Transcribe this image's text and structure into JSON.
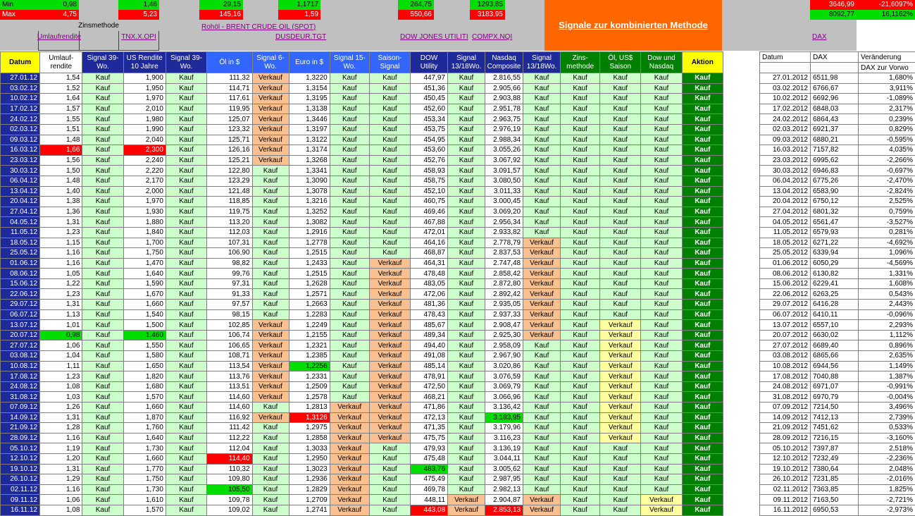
{
  "top": {
    "min_label": "Min",
    "max_label": "Max",
    "min_vals": [
      "0,98",
      "1,46",
      "29,15",
      "1,1717",
      "264,75",
      "1293,85"
    ],
    "max_vals": [
      "4,75",
      "5,23",
      "145,16",
      "1,59",
      "550,66",
      "3183,95"
    ],
    "dax_min": [
      "3646,99",
      "-21,6097%"
    ],
    "dax_max": [
      "8092,77",
      "16,1162%"
    ],
    "zinsmethode": "Zinsmethode",
    "links": {
      "umlauf": "Umlaufrendite",
      "tnx": "TNX.X.OPI",
      "oil": "Rohöl - BRENT CRUDE OIL (SPOT)",
      "eur": "DUSDEUR.TGT",
      "dow": "DOW JONES UTILITI",
      "compx": "COMPX.NQI",
      "dax": "DAX"
    },
    "signal_title": "Signale zur kombinierten Methode"
  },
  "headers": {
    "datum": "Datum",
    "umlauf": "Umlauf-rendite",
    "sig39a": "Signal 39-Wo.",
    "usr": "US Rendite 10 Jahre",
    "sig39b": "Signal 39-Wo.",
    "oel": "Öl in $",
    "sig6": "Signal 6-Wo.",
    "euro": "Euro in $",
    "sig15": "Signal 15-Wo.",
    "saison": "Saison-Signal",
    "dow": "DOW Utility",
    "sig13a": "Signal 13/18Wo.",
    "nasdaq": "Nasdaq Composite",
    "sig13b": "Signal 13/18Wo.",
    "zins": "Zins-methode",
    "oelus": "Öl, US$ Saison",
    "downdq": "Dow und Nasdaq",
    "aktion": "Aktion"
  },
  "dax_headers": {
    "datum": "Datum",
    "dax": "DAX",
    "ver": "Veränderung",
    "ver2": "DAX zur Vorwo"
  },
  "colors": {
    "navy": "#1e2a9a",
    "light_green": "#ccffcc",
    "orange": "#fac090",
    "dark_green": "#008000",
    "signal_orange": "#ff6600"
  },
  "rows": [
    [
      "27.01.12",
      "1,54",
      "Kauf",
      "1,900",
      "Kauf",
      "111,32",
      "Verkauf",
      "1,3220",
      "Kauf",
      "Kauf",
      "447,97",
      "Kauf",
      "2.816,55",
      "Kauf",
      "Kauf",
      "Kauf",
      "Kauf",
      "Kauf"
    ],
    [
      "03.02.12",
      "1,52",
      "Kauf",
      "1,950",
      "Kauf",
      "114,71",
      "Verkauf",
      "1,3154",
      "Kauf",
      "Kauf",
      "451,36",
      "Kauf",
      "2.905,66",
      "Kauf",
      "Kauf",
      "Kauf",
      "Kauf",
      "Kauf"
    ],
    [
      "10.02.12",
      "1,64",
      "Kauf",
      "1,970",
      "Kauf",
      "117,61",
      "Verkauf",
      "1,3195",
      "Kauf",
      "Kauf",
      "450,45",
      "Kauf",
      "2.903,88",
      "Kauf",
      "Kauf",
      "Kauf",
      "Kauf",
      "Kauf"
    ],
    [
      "17.02.12",
      "1,57",
      "Kauf",
      "2,010",
      "Kauf",
      "119,95",
      "Verkauf",
      "1,3138",
      "Kauf",
      "Kauf",
      "452,60",
      "Kauf",
      "2.951,78",
      "Kauf",
      "Kauf",
      "Kauf",
      "Kauf",
      "Kauf"
    ],
    [
      "24.02.12",
      "1,55",
      "Kauf",
      "1,980",
      "Kauf",
      "125,07",
      "Verkauf",
      "1,3446",
      "Kauf",
      "Kauf",
      "453,34",
      "Kauf",
      "2.963,75",
      "Kauf",
      "Kauf",
      "Kauf",
      "Kauf",
      "Kauf"
    ],
    [
      "02.03.12",
      "1,51",
      "Kauf",
      "1,990",
      "Kauf",
      "123,32",
      "Verkauf",
      "1,3197",
      "Kauf",
      "Kauf",
      "453,75",
      "Kauf",
      "2.976,19",
      "Kauf",
      "Kauf",
      "Kauf",
      "Kauf",
      "Kauf"
    ],
    [
      "09.03.12",
      "1,48",
      "Kauf",
      "2,040",
      "Kauf",
      "125,71",
      "Verkauf",
      "1,3122",
      "Kauf",
      "Kauf",
      "454,95",
      "Kauf",
      "2.988,34",
      "Kauf",
      "Kauf",
      "Kauf",
      "Kauf",
      "Kauf"
    ],
    [
      "16.03.12",
      "1,66",
      "Kauf",
      "2,300",
      "Kauf",
      "126,16",
      "Verkauf",
      "1,3174",
      "Kauf",
      "Kauf",
      "453,60",
      "Kauf",
      "3.055,26",
      "Kauf",
      "Kauf",
      "Kauf",
      "Kauf",
      "Kauf"
    ],
    [
      "23.03.12",
      "1,56",
      "Kauf",
      "2,240",
      "Kauf",
      "125,21",
      "Verkauf",
      "1,3268",
      "Kauf",
      "Kauf",
      "452,76",
      "Kauf",
      "3.067,92",
      "Kauf",
      "Kauf",
      "Kauf",
      "Kauf",
      "Kauf"
    ],
    [
      "30.03.12",
      "1,50",
      "Kauf",
      "2,220",
      "Kauf",
      "122,80",
      "Kauf",
      "1,3341",
      "Kauf",
      "Kauf",
      "458,93",
      "Kauf",
      "3.091,57",
      "Kauf",
      "Kauf",
      "Kauf",
      "Kauf",
      "Kauf"
    ],
    [
      "06.04.12",
      "1,48",
      "Kauf",
      "2,170",
      "Kauf",
      "123,29",
      "Kauf",
      "1,3090",
      "Kauf",
      "Kauf",
      "458,75",
      "Kauf",
      "3.080,50",
      "Kauf",
      "Kauf",
      "Kauf",
      "Kauf",
      "Kauf"
    ],
    [
      "13.04.12",
      "1,40",
      "Kauf",
      "2,000",
      "Kauf",
      "121,48",
      "Kauf",
      "1,3078",
      "Kauf",
      "Kauf",
      "452,10",
      "Kauf",
      "3.011,33",
      "Kauf",
      "Kauf",
      "Kauf",
      "Kauf",
      "Kauf"
    ],
    [
      "20.04.12",
      "1,38",
      "Kauf",
      "1,970",
      "Kauf",
      "118,85",
      "Kauf",
      "1,3216",
      "Kauf",
      "Kauf",
      "460,75",
      "Kauf",
      "3.000,45",
      "Kauf",
      "Kauf",
      "Kauf",
      "Kauf",
      "Kauf"
    ],
    [
      "27.04.12",
      "1,36",
      "Kauf",
      "1,930",
      "Kauf",
      "119,75",
      "Kauf",
      "1,3252",
      "Kauf",
      "Kauf",
      "469,46",
      "Kauf",
      "3.069,20",
      "Kauf",
      "Kauf",
      "Kauf",
      "Kauf",
      "Kauf"
    ],
    [
      "04.05.12",
      "1,31",
      "Kauf",
      "1,880",
      "Kauf",
      "113,20",
      "Kauf",
      "1,3082",
      "Kauf",
      "Kauf",
      "467,88",
      "Kauf",
      "2.956,34",
      "Kauf",
      "Kauf",
      "Kauf",
      "Kauf",
      "Kauf"
    ],
    [
      "11.05.12",
      "1,23",
      "Kauf",
      "1,840",
      "Kauf",
      "112,03",
      "Kauf",
      "1,2916",
      "Kauf",
      "Kauf",
      "472,01",
      "Kauf",
      "2.933,82",
      "Kauf",
      "Kauf",
      "Kauf",
      "Kauf",
      "Kauf"
    ],
    [
      "18.05.12",
      "1,15",
      "Kauf",
      "1,700",
      "Kauf",
      "107,31",
      "Kauf",
      "1,2778",
      "Kauf",
      "Kauf",
      "464,16",
      "Kauf",
      "2.778,79",
      "Verkauf",
      "Kauf",
      "Kauf",
      "Kauf",
      "Kauf"
    ],
    [
      "25.05.12",
      "1,16",
      "Kauf",
      "1,750",
      "Kauf",
      "106,90",
      "Kauf",
      "1,2515",
      "Kauf",
      "Kauf",
      "468,87",
      "Kauf",
      "2.837,53",
      "Verkauf",
      "Kauf",
      "Kauf",
      "Kauf",
      "Kauf"
    ],
    [
      "01.06.12",
      "1,16",
      "Kauf",
      "1,470",
      "Kauf",
      "98,82",
      "Kauf",
      "1,2433",
      "Kauf",
      "Verkauf",
      "464,31",
      "Kauf",
      "2.747,48",
      "Verkauf",
      "Kauf",
      "Kauf",
      "Kauf",
      "Kauf"
    ],
    [
      "08.06.12",
      "1,05",
      "Kauf",
      "1,640",
      "Kauf",
      "99,76",
      "Kauf",
      "1,2515",
      "Kauf",
      "Verkauf",
      "478,48",
      "Kauf",
      "2.858,42",
      "Verkauf",
      "Kauf",
      "Kauf",
      "Kauf",
      "Kauf"
    ],
    [
      "15.06.12",
      "1,22",
      "Kauf",
      "1,590",
      "Kauf",
      "97,31",
      "Kauf",
      "1,2628",
      "Kauf",
      "Verkauf",
      "483,05",
      "Kauf",
      "2.872,80",
      "Verkauf",
      "Kauf",
      "Kauf",
      "Kauf",
      "Kauf"
    ],
    [
      "22.06.12",
      "1,23",
      "Kauf",
      "1,670",
      "Kauf",
      "91,33",
      "Kauf",
      "1,2571",
      "Kauf",
      "Verkauf",
      "472,06",
      "Kauf",
      "2.892,42",
      "Verkauf",
      "Kauf",
      "Kauf",
      "Kauf",
      "Kauf"
    ],
    [
      "29.07.12",
      "1,31",
      "Kauf",
      "1,660",
      "Kauf",
      "97,57",
      "Kauf",
      "1,2663",
      "Kauf",
      "Verkauf",
      "481,36",
      "Kauf",
      "2.935,05",
      "Verkauf",
      "Kauf",
      "Kauf",
      "Kauf",
      "Kauf"
    ],
    [
      "06.07.12",
      "1,13",
      "Kauf",
      "1,540",
      "Kauf",
      "98,15",
      "Kauf",
      "1,2283",
      "Kauf",
      "Verkauf",
      "478,43",
      "Kauf",
      "2.937,33",
      "Verkauf",
      "Kauf",
      "Kauf",
      "Kauf",
      "Kauf"
    ],
    [
      "13.07.12",
      "1,01",
      "Kauf",
      "1,500",
      "Kauf",
      "102,85",
      "Verkauf",
      "1,2249",
      "Kauf",
      "Verkauf",
      "485,67",
      "Kauf",
      "2.908,47",
      "Verkauf",
      "Kauf",
      "Verkauf",
      "Kauf",
      "Kauf"
    ],
    [
      "20.07.12",
      "0,98",
      "Kauf",
      "1,460",
      "Kauf",
      "106,74",
      "Verkauf",
      "1,2155",
      "Kauf",
      "Verkauf",
      "489,34",
      "Kauf",
      "2.925,30",
      "Verkauf",
      "Kauf",
      "Verkauf",
      "Kauf",
      "Kauf"
    ],
    [
      "27.07.12",
      "1,06",
      "Kauf",
      "1,550",
      "Kauf",
      "106,65",
      "Verkauf",
      "1,2321",
      "Kauf",
      "Verkauf",
      "494,40",
      "Kauf",
      "2.958,09",
      "Kauf",
      "Kauf",
      "Verkauf",
      "Kauf",
      "Kauf"
    ],
    [
      "03.08.12",
      "1,04",
      "Kauf",
      "1,580",
      "Kauf",
      "108,71",
      "Verkauf",
      "1,2385",
      "Kauf",
      "Verkauf",
      "491,08",
      "Kauf",
      "2.967,90",
      "Kauf",
      "Kauf",
      "Verkauf",
      "Kauf",
      "Kauf"
    ],
    [
      "10.08.12",
      "1,11",
      "Kauf",
      "1,650",
      "Kauf",
      "113,54",
      "Verkauf",
      "1,2256",
      "Kauf",
      "Verkauf",
      "485,14",
      "Kauf",
      "3.020,86",
      "Kauf",
      "Kauf",
      "Verkauf",
      "Kauf",
      "Kauf"
    ],
    [
      "17.08.12",
      "1,23",
      "Kauf",
      "1,820",
      "Kauf",
      "113,76",
      "Verkauf",
      "1,2331",
      "Kauf",
      "Verkauf",
      "478,91",
      "Kauf",
      "3.076,59",
      "Kauf",
      "Kauf",
      "Verkauf",
      "Kauf",
      "Kauf"
    ],
    [
      "24.08.12",
      "1,08",
      "Kauf",
      "1,680",
      "Kauf",
      "113,51",
      "Verkauf",
      "1,2509",
      "Kauf",
      "Verkauf",
      "472,50",
      "Kauf",
      "3.069,79",
      "Kauf",
      "Kauf",
      "Verkauf",
      "Kauf",
      "Kauf"
    ],
    [
      "31.08.12",
      "1,03",
      "Kauf",
      "1,570",
      "Kauf",
      "114,60",
      "Verkauf",
      "1,2578",
      "Kauf",
      "Verkauf",
      "468,21",
      "Kauf",
      "3.066,96",
      "Kauf",
      "Kauf",
      "Verkauf",
      "Kauf",
      "Kauf"
    ],
    [
      "07.09.12",
      "1,26",
      "Kauf",
      "1,660",
      "Kauf",
      "114,60",
      "Kauf",
      "1,2813",
      "Verkauf",
      "Verkauf",
      "471,86",
      "Kauf",
      "3.136,42",
      "Kauf",
      "Kauf",
      "Verkauf",
      "Kauf",
      "Kauf"
    ],
    [
      "14.09.12",
      "1,31",
      "Kauf",
      "1,870",
      "Kauf",
      "116,92",
      "Verkauf",
      "1,3126",
      "Verkauf",
      "Verkauf",
      "472,13",
      "Kauf",
      "3.183,95",
      "Kauf",
      "Kauf",
      "Verkauf",
      "Kauf",
      "Kauf"
    ],
    [
      "21.09.12",
      "1,28",
      "Kauf",
      "1,760",
      "Kauf",
      "111,42",
      "Kauf",
      "1,2975",
      "Verkauf",
      "Verkauf",
      "471,35",
      "Kauf",
      "3.179,96",
      "Kauf",
      "Kauf",
      "Verkauf",
      "Kauf",
      "Kauf"
    ],
    [
      "28.09.12",
      "1,16",
      "Kauf",
      "1,640",
      "Kauf",
      "112,22",
      "Kauf",
      "1,2858",
      "Verkauf",
      "Verkauf",
      "475,75",
      "Kauf",
      "3.116,23",
      "Kauf",
      "Kauf",
      "Verkauf",
      "Kauf",
      "Kauf"
    ],
    [
      "05.10.12",
      "1,19",
      "Kauf",
      "1,730",
      "Kauf",
      "112,04",
      "Kauf",
      "1,3033",
      "Verkauf",
      "Kauf",
      "479,93",
      "Kauf",
      "3.136,19",
      "Kauf",
      "Kauf",
      "Kauf",
      "Kauf",
      "Kauf"
    ],
    [
      "12.10.12",
      "1,20",
      "Kauf",
      "1,660",
      "Kauf",
      "114,40",
      "Kauf",
      "1,2950",
      "Verkauf",
      "Kauf",
      "475,48",
      "Kauf",
      "3.044,11",
      "Kauf",
      "Kauf",
      "Kauf",
      "Kauf",
      "Kauf"
    ],
    [
      "19.10.12",
      "1,31",
      "Kauf",
      "1,770",
      "Kauf",
      "110,32",
      "Kauf",
      "1,3023",
      "Verkauf",
      "Kauf",
      "483,76",
      "Kauf",
      "3.005,62",
      "Kauf",
      "Kauf",
      "Kauf",
      "Kauf",
      "Kauf"
    ],
    [
      "26.10.12",
      "1,29",
      "Kauf",
      "1,750",
      "Kauf",
      "109,80",
      "Kauf",
      "1,2936",
      "Verkauf",
      "Kauf",
      "475,49",
      "Kauf",
      "2.987,95",
      "Kauf",
      "Kauf",
      "Kauf",
      "Kauf",
      "Kauf"
    ],
    [
      "02.11.12",
      "1,16",
      "Kauf",
      "1,730",
      "Kauf",
      "105,50",
      "Kauf",
      "1,2829",
      "Verkauf",
      "Kauf",
      "469,78",
      "Kauf",
      "2.982,13",
      "Kauf",
      "Kauf",
      "Kauf",
      "Kauf",
      "Kauf"
    ],
    [
      "09.11.12",
      "1,06",
      "Kauf",
      "1,610",
      "Kauf",
      "109,78",
      "Kauf",
      "1,2709",
      "Verkauf",
      "Kauf",
      "448,11",
      "Verkauf",
      "2.904,87",
      "Verkauf",
      "Kauf",
      "Kauf",
      "Verkauf",
      "Kauf"
    ],
    [
      "16.11.12",
      "1,08",
      "Kauf",
      "1,570",
      "Kauf",
      "109,02",
      "Kauf",
      "1,2741",
      "Verkauf",
      "Kauf",
      "443,08",
      "Verkauf",
      "2.853,13",
      "Verkauf",
      "Kauf",
      "Kauf",
      "Verkauf",
      "Kauf"
    ]
  ],
  "highlights": [
    {
      "row": 7,
      "col": 1,
      "kind": "red"
    },
    {
      "row": 7,
      "col": 3,
      "kind": "red"
    },
    {
      "row": 25,
      "col": 1,
      "kind": "green"
    },
    {
      "row": 25,
      "col": 3,
      "kind": "green"
    },
    {
      "row": 28,
      "col": 7,
      "kind": "green"
    },
    {
      "row": 33,
      "col": 7,
      "kind": "red"
    },
    {
      "row": 33,
      "col": 12,
      "kind": "green"
    },
    {
      "row": 37,
      "col": 5,
      "kind": "red"
    },
    {
      "row": 38,
      "col": 10,
      "kind": "green"
    },
    {
      "row": 40,
      "col": 5,
      "kind": "green"
    },
    {
      "row": 42,
      "col": 10,
      "kind": "red"
    },
    {
      "row": 42,
      "col": 12,
      "kind": "red"
    }
  ],
  "dax_rows": [
    [
      "27.01.2012",
      "6511,98",
      "1,680%"
    ],
    [
      "03.02.2012",
      "6766,67",
      "3,911%"
    ],
    [
      "10.02.2012",
      "6692,96",
      "-1,089%"
    ],
    [
      "17.02.2012",
      "6848,03",
      "2,317%"
    ],
    [
      "24.02.2012",
      "6864,43",
      "0,239%"
    ],
    [
      "02.03.2012",
      "6921,37",
      "0,829%"
    ],
    [
      "09.03.2012",
      "6880,21",
      "-0,595%"
    ],
    [
      "16.03.2012",
      "7157,82",
      "4,035%"
    ],
    [
      "23.03.2012",
      "6995,62",
      "-2,266%"
    ],
    [
      "30.03.2012",
      "6946,83",
      "-0,697%"
    ],
    [
      "06.04.2012",
      "6775,26",
      "-2,470%"
    ],
    [
      "13.04.2012",
      "6583,90",
      "-2,824%"
    ],
    [
      "20.04.2012",
      "6750,12",
      "2,525%"
    ],
    [
      "27.04.2012",
      "6801,32",
      "0,759%"
    ],
    [
      "04.05.2012",
      "6561,47",
      "-3,527%"
    ],
    [
      "11.05.2012",
      "6579,93",
      "0,281%"
    ],
    [
      "18.05.2012",
      "6271,22",
      "-4,692%"
    ],
    [
      "25.05.2012",
      "6339,94",
      "1,096%"
    ],
    [
      "01.06.2012",
      "6050,29",
      "-4,569%"
    ],
    [
      "08.06.2012",
      "6130,82",
      "1,331%"
    ],
    [
      "15.06.2012",
      "6229,41",
      "1,608%"
    ],
    [
      "22.06.2012",
      "6263,25",
      "0,543%"
    ],
    [
      "29.07.2012",
      "6416,28",
      "2,443%"
    ],
    [
      "06.07.2012",
      "6410,11",
      "-0,096%"
    ],
    [
      "13.07.2012",
      "6557,10",
      "2,293%"
    ],
    [
      "20.07.2012",
      "6630,02",
      "1,112%"
    ],
    [
      "27.07.2012",
      "6689,40",
      "0,896%"
    ],
    [
      "03.08.2012",
      "6865,66",
      "2,635%"
    ],
    [
      "10.08.2012",
      "6944,56",
      "1,149%"
    ],
    [
      "17.08.2012",
      "7040,88",
      "1,387%"
    ],
    [
      "24.08.2012",
      "6971,07",
      "-0,991%"
    ],
    [
      "31.08.2012",
      "6970,79",
      "-0,004%"
    ],
    [
      "07.09.2012",
      "7214,50",
      "3,496%"
    ],
    [
      "14.09.2012",
      "7412,13",
      "2,739%"
    ],
    [
      "21.09.2012",
      "7451,62",
      "0,533%"
    ],
    [
      "28.09.2012",
      "7216,15",
      "-3,160%"
    ],
    [
      "05.10.2012",
      "7397,87",
      "2,518%"
    ],
    [
      "12.10.2012",
      "7232,49",
      "-2,236%"
    ],
    [
      "19.10.2012",
      "7380,64",
      "2,048%"
    ],
    [
      "26.10.2012",
      "7231,85",
      "-2,016%"
    ],
    [
      "02.11.2012",
      "7363,85",
      "1,825%"
    ],
    [
      "09.11.2012",
      "7163,50",
      "-2,721%"
    ],
    [
      "16.11.2012",
      "6950,53",
      "-2,973%"
    ]
  ]
}
